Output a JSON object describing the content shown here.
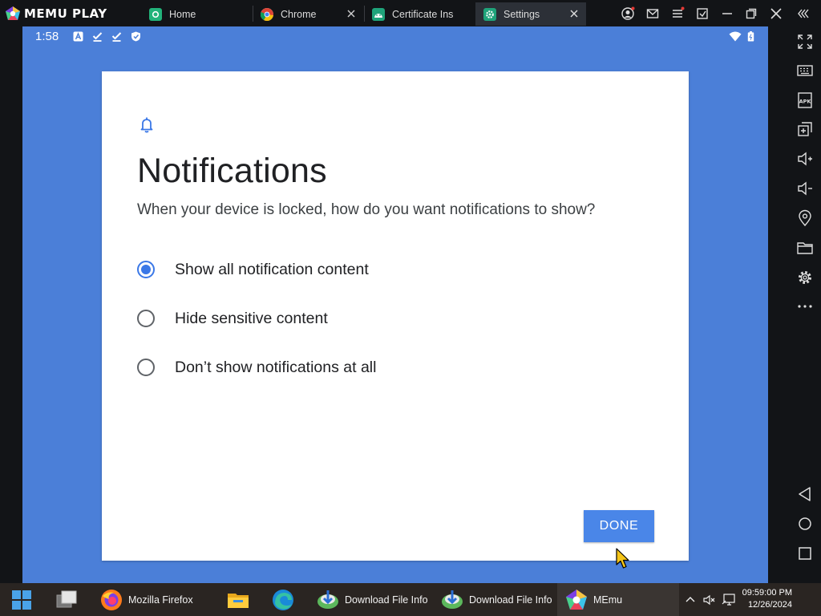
{
  "app": {
    "brand": "MEMU PLAY",
    "tabs": [
      {
        "label": "Home",
        "icon": "home-app-icon"
      },
      {
        "label": "Chrome",
        "icon": "chrome-icon"
      },
      {
        "label": "Certificate Ins",
        "icon": "android-icon"
      },
      {
        "label": "Settings",
        "icon": "settings-icon",
        "active": true
      }
    ]
  },
  "status_bar": {
    "time": "1:58",
    "icons": [
      "a-icon",
      "download-done-icon",
      "download-done-icon",
      "shield-icon",
      "wifi-icon",
      "battery-icon"
    ]
  },
  "dialog": {
    "icon": "bell-icon",
    "title": "Notifications",
    "subtitle": "When your device is locked, how do you want notifications to show?",
    "options": [
      {
        "label": "Show all notification content",
        "selected": true
      },
      {
        "label": "Hide sensitive content",
        "selected": false
      },
      {
        "label": "Don’t show notifications at all",
        "selected": false
      }
    ],
    "done_label": "DONE"
  },
  "sidebar": {
    "icons": [
      "fullscreen-icon",
      "keyboard-icon",
      "apk-icon",
      "multi-window-icon",
      "volume-up-icon",
      "volume-down-icon",
      "location-icon",
      "folder-icon",
      "settings-gear-icon",
      "more-icon",
      "back-icon",
      "home-icon",
      "recents-icon"
    ]
  },
  "taskbar": {
    "items": [
      {
        "label": "",
        "icon": "windows-start-icon"
      },
      {
        "label": "",
        "icon": "task-view-icon"
      },
      {
        "label": "Mozilla Firefox",
        "icon": "firefox-icon"
      },
      {
        "label": "",
        "icon": "file-explorer-icon"
      },
      {
        "label": "",
        "icon": "edge-icon"
      },
      {
        "label": "Download File Info",
        "icon": "idm-icon"
      },
      {
        "label": "Download File Info",
        "icon": "idm-icon"
      },
      {
        "label": "MEmu",
        "icon": "memu-icon"
      }
    ],
    "time": "09:59:00 PM",
    "date": "12/26/2024"
  },
  "colors": {
    "screen_bg": "#4b7fd8",
    "accent": "#3b78e7",
    "button": "#4a86e8",
    "titlebar": "#121417",
    "taskbar": "#2a2522"
  }
}
